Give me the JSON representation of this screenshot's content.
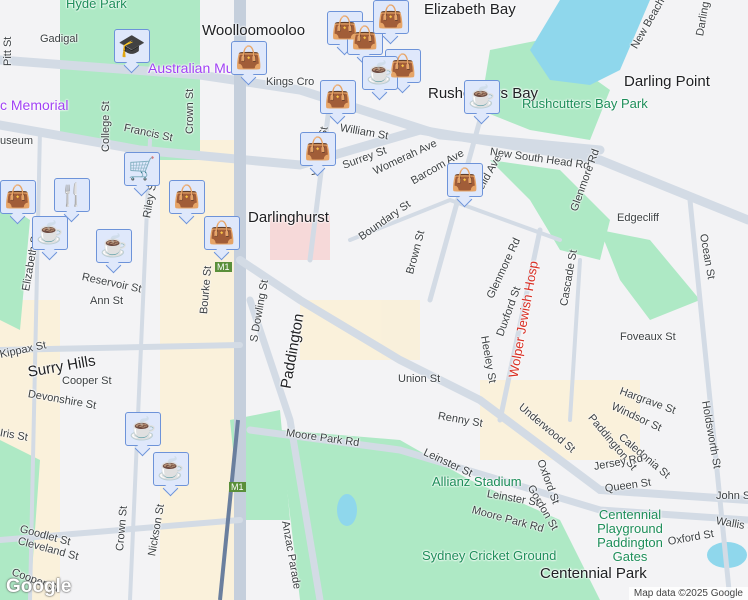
{
  "map": {
    "colors": {
      "water": "#8fd7ec",
      "park": "#aee9c5",
      "road": "#d3dbe5",
      "background": "#f3f3f5",
      "pin": "#0f4a6e",
      "accent": "#a142f4"
    },
    "labels": [
      {
        "text": "Hyde Park",
        "kind": "park"
      },
      {
        "text": "Gadigal",
        "kind": "lbl"
      },
      {
        "text": "Woolloomooloo",
        "kind": "big"
      },
      {
        "text": "Elizabeth Bay",
        "kind": "big"
      },
      {
        "text": "Australian Mu",
        "kind": "poi"
      },
      {
        "text": "Kings Cro",
        "kind": "lbl"
      },
      {
        "text": "c Memorial",
        "kind": "poi"
      },
      {
        "text": "Francis St",
        "kind": "lbl"
      },
      {
        "text": "useum",
        "kind": "lbl"
      },
      {
        "text": "College St",
        "kind": "lbl"
      },
      {
        "text": "Crown St",
        "kind": "lbl"
      },
      {
        "text": "Pitt St",
        "kind": "lbl"
      },
      {
        "text": "William St",
        "kind": "lbl"
      },
      {
        "text": "Surrey St",
        "kind": "lbl"
      },
      {
        "text": "Victoria St",
        "kind": "lbl"
      },
      {
        "text": "Darlinghurst",
        "kind": "big"
      },
      {
        "text": "Riley St",
        "kind": "lbl"
      },
      {
        "text": "Reservoir St",
        "kind": "lbl"
      },
      {
        "text": "Elizabeth St",
        "kind": "lbl"
      },
      {
        "text": "Ann St",
        "kind": "lbl"
      },
      {
        "text": "Bourke St",
        "kind": "lbl"
      },
      {
        "text": "S Dowling St",
        "kind": "lbl"
      },
      {
        "text": "Rushcutters Bay",
        "kind": "big"
      },
      {
        "text": "Rushcutters Bay Park",
        "kind": "park"
      },
      {
        "text": "Darling Point",
        "kind": "big"
      },
      {
        "text": "New Beach Rd",
        "kind": "lbl"
      },
      {
        "text": "Darling Point Rd",
        "kind": "lbl"
      },
      {
        "text": "New South Head Rd",
        "kind": "lbl"
      },
      {
        "text": "Womerah Ave",
        "kind": "lbl"
      },
      {
        "text": "Barcom Ave",
        "kind": "lbl"
      },
      {
        "text": "Neild Ave",
        "kind": "lbl"
      },
      {
        "text": "Boundary St",
        "kind": "lbl"
      },
      {
        "text": "Brown St",
        "kind": "lbl"
      },
      {
        "text": "Glenmore Rd",
        "kind": "lbl"
      },
      {
        "text": "Glenmore Rd",
        "kind": "lbl"
      },
      {
        "text": "Edgecliff",
        "kind": "lbl"
      },
      {
        "text": "Ocean St",
        "kind": "lbl"
      },
      {
        "text": "Cascade St",
        "kind": "lbl"
      },
      {
        "text": "Heeley St",
        "kind": "lbl"
      },
      {
        "text": "Duxford St",
        "kind": "lbl"
      },
      {
        "text": "Wolper Jewish Hosp",
        "kind": "red"
      },
      {
        "text": "Foveaux St",
        "kind": "lbl"
      },
      {
        "text": "Kippax St",
        "kind": "lbl"
      },
      {
        "text": "Surry Hills",
        "kind": "big"
      },
      {
        "text": "Cooper St",
        "kind": "lbl"
      },
      {
        "text": "Devonshire St",
        "kind": "lbl"
      },
      {
        "text": "Iris St",
        "kind": "lbl"
      },
      {
        "text": "Paddington",
        "kind": "big"
      },
      {
        "text": "Union St",
        "kind": "lbl"
      },
      {
        "text": "Hargrave St",
        "kind": "lbl"
      },
      {
        "text": "Windsor St",
        "kind": "lbl"
      },
      {
        "text": "Paddington St",
        "kind": "lbl"
      },
      {
        "text": "Caledonia St",
        "kind": "lbl"
      },
      {
        "text": "Holdsworth St",
        "kind": "lbl"
      },
      {
        "text": "Renny St",
        "kind": "lbl"
      },
      {
        "text": "Underwood St",
        "kind": "lbl"
      },
      {
        "text": "Moore Park Rd",
        "kind": "lbl"
      },
      {
        "text": "Leinster St",
        "kind": "lbl"
      },
      {
        "text": "Allianz Stadium",
        "kind": "park"
      },
      {
        "text": "Oxford St",
        "kind": "lbl"
      },
      {
        "text": "Jersey Rd",
        "kind": "lbl"
      },
      {
        "text": "Queen St",
        "kind": "lbl"
      },
      {
        "text": "Gordon St",
        "kind": "lbl"
      },
      {
        "text": "Leinster St",
        "kind": "lbl"
      },
      {
        "text": "Moore Park Rd",
        "kind": "lbl"
      },
      {
        "text": "Centennial Playground Paddington Gates",
        "kind": "park"
      },
      {
        "text": "Oxford St",
        "kind": "lbl"
      },
      {
        "text": "John St",
        "kind": "lbl"
      },
      {
        "text": "Wallis St",
        "kind": "lbl"
      },
      {
        "text": "Goodlet St",
        "kind": "lbl"
      },
      {
        "text": "Cleveland St",
        "kind": "lbl"
      },
      {
        "text": "Crown St",
        "kind": "lbl"
      },
      {
        "text": "Nickson St",
        "kind": "lbl"
      },
      {
        "text": "Anzac Parade",
        "kind": "lbl"
      },
      {
        "text": "Sydney Cricket Ground",
        "kind": "park"
      },
      {
        "text": "Centennial Park",
        "kind": "big"
      },
      {
        "text": "Cooper St",
        "kind": "lbl"
      },
      {
        "text": "M1",
        "kind": "lbl"
      },
      {
        "text": "M1",
        "kind": "lbl"
      }
    ],
    "pins": [
      "school",
      "shopping",
      "shopping",
      "shopping",
      "shopping",
      "shopping",
      "cafe",
      "shopping",
      "cafe",
      "cart",
      "restaurant",
      "shopping",
      "shopping",
      "shopping",
      "cafe",
      "cafe",
      "shopping",
      "shopping",
      "cafe",
      "cafe"
    ],
    "attribution": "Map data ©2025 Google",
    "logo": "Google"
  }
}
